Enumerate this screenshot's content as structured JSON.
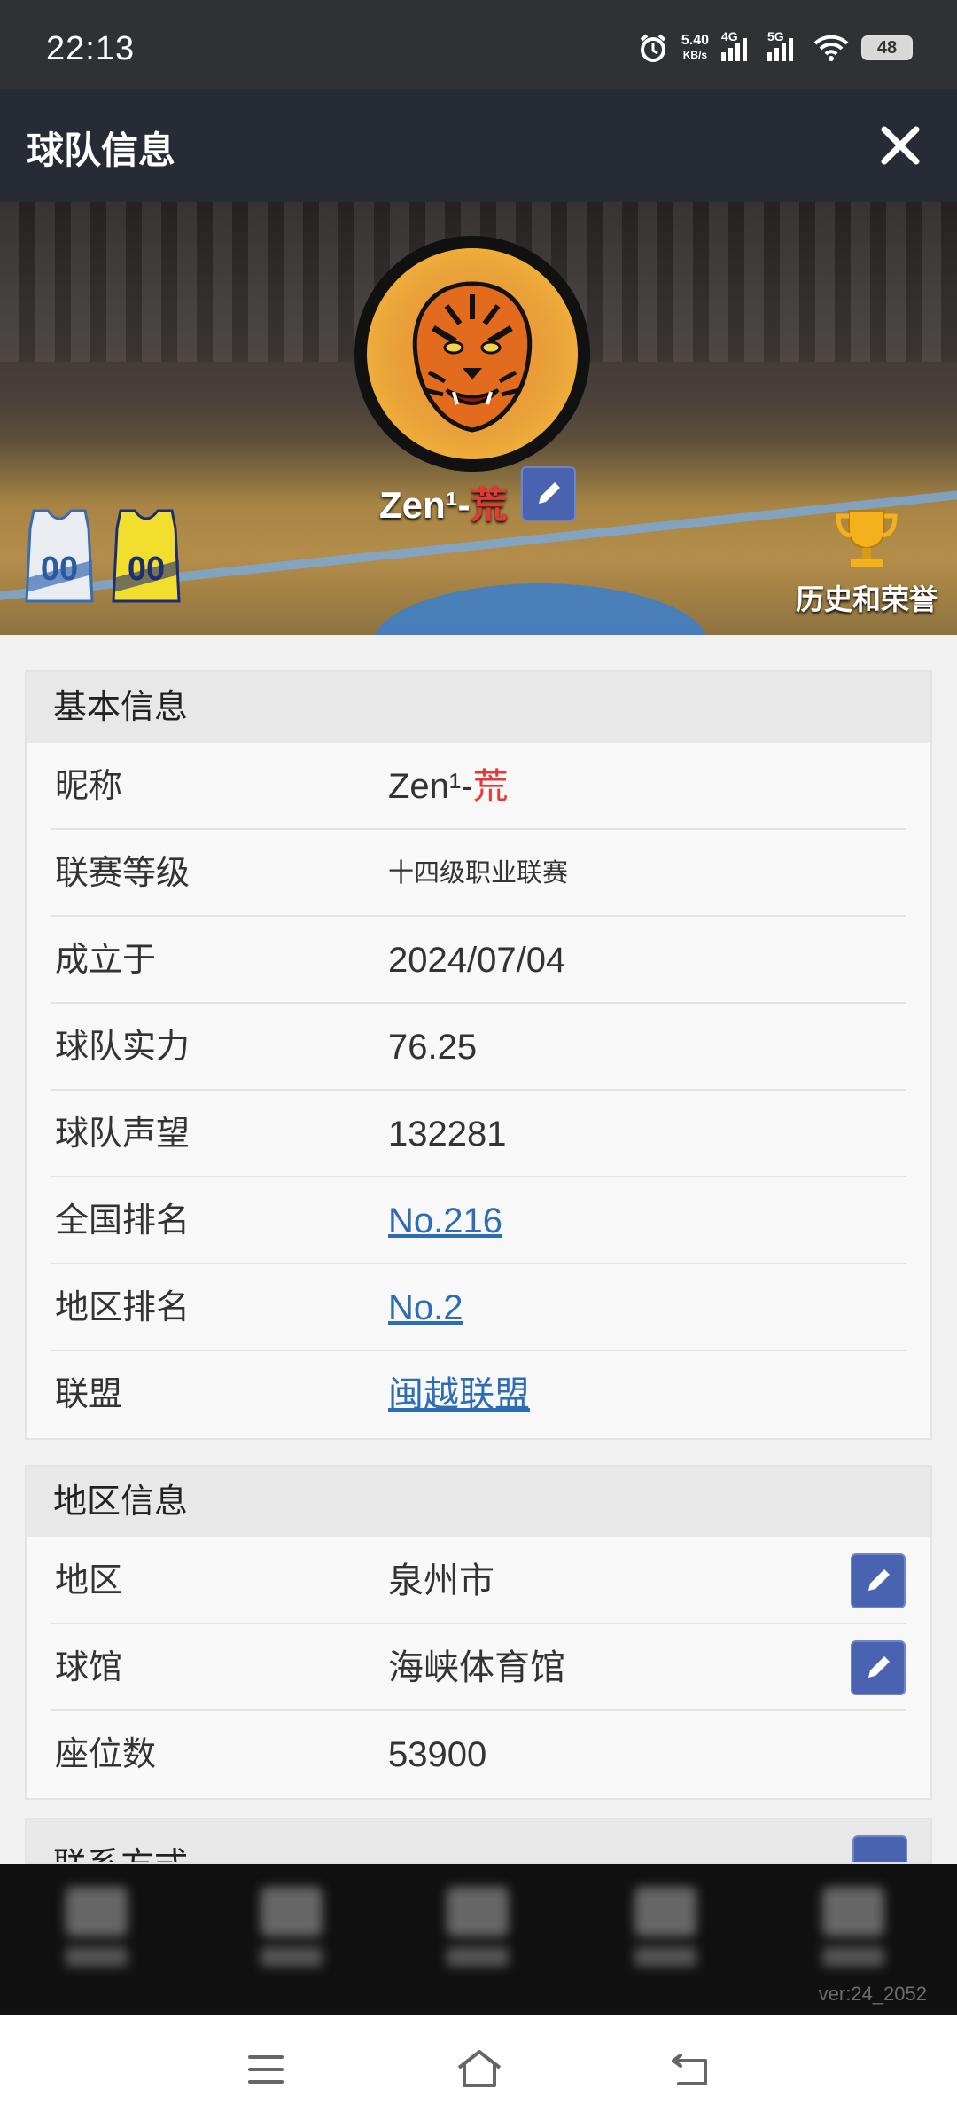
{
  "status_bar": {
    "time": "22:13",
    "net_speed_value": "5.40",
    "net_speed_unit": "KB/s",
    "signal1_label": "4G",
    "signal2_label": "5G",
    "battery": "48"
  },
  "header": {
    "title": "球队信息"
  },
  "banner": {
    "team_name_prefix": "Zen¹-",
    "team_name_suffix": "荒",
    "jersey_home_number": "00",
    "jersey_away_number": "00",
    "honor_label": "历史和荣誉"
  },
  "basic_info": {
    "title": "基本信息",
    "rows": [
      {
        "label": "昵称",
        "value_prefix": "Zen¹-",
        "value_suffix": "荒"
      },
      {
        "label": "联赛等级",
        "value": "十四级职业联赛"
      },
      {
        "label": "成立于",
        "value": "2024/07/04"
      },
      {
        "label": "球队实力",
        "value": "76.25"
      },
      {
        "label": "球队声望",
        "value": "132281"
      },
      {
        "label": "全国排名",
        "value": "No.216"
      },
      {
        "label": "地区排名",
        "value": "No.2"
      },
      {
        "label": "联盟",
        "value": "闽越联盟"
      }
    ]
  },
  "region_info": {
    "title": "地区信息",
    "rows": [
      {
        "label": "地区",
        "value": "泉州市"
      },
      {
        "label": "球馆",
        "value": "海峡体育馆"
      },
      {
        "label": "座位数",
        "value": "53900"
      }
    ]
  },
  "contact_info": {
    "title": "联系方式"
  },
  "footer": {
    "version": "ver:24_2052"
  },
  "colors": {
    "accent_link": "#2d6db5",
    "accent_red": "#e53935",
    "edit_button": "#4a63b0",
    "header_bg": "#262b36"
  },
  "icons": [
    "alarm-icon",
    "signal-icon",
    "wifi-icon",
    "battery-icon",
    "close-icon",
    "pencil-icon",
    "trophy-icon",
    "jersey-icon",
    "menu-icon",
    "home-icon",
    "back-icon"
  ]
}
